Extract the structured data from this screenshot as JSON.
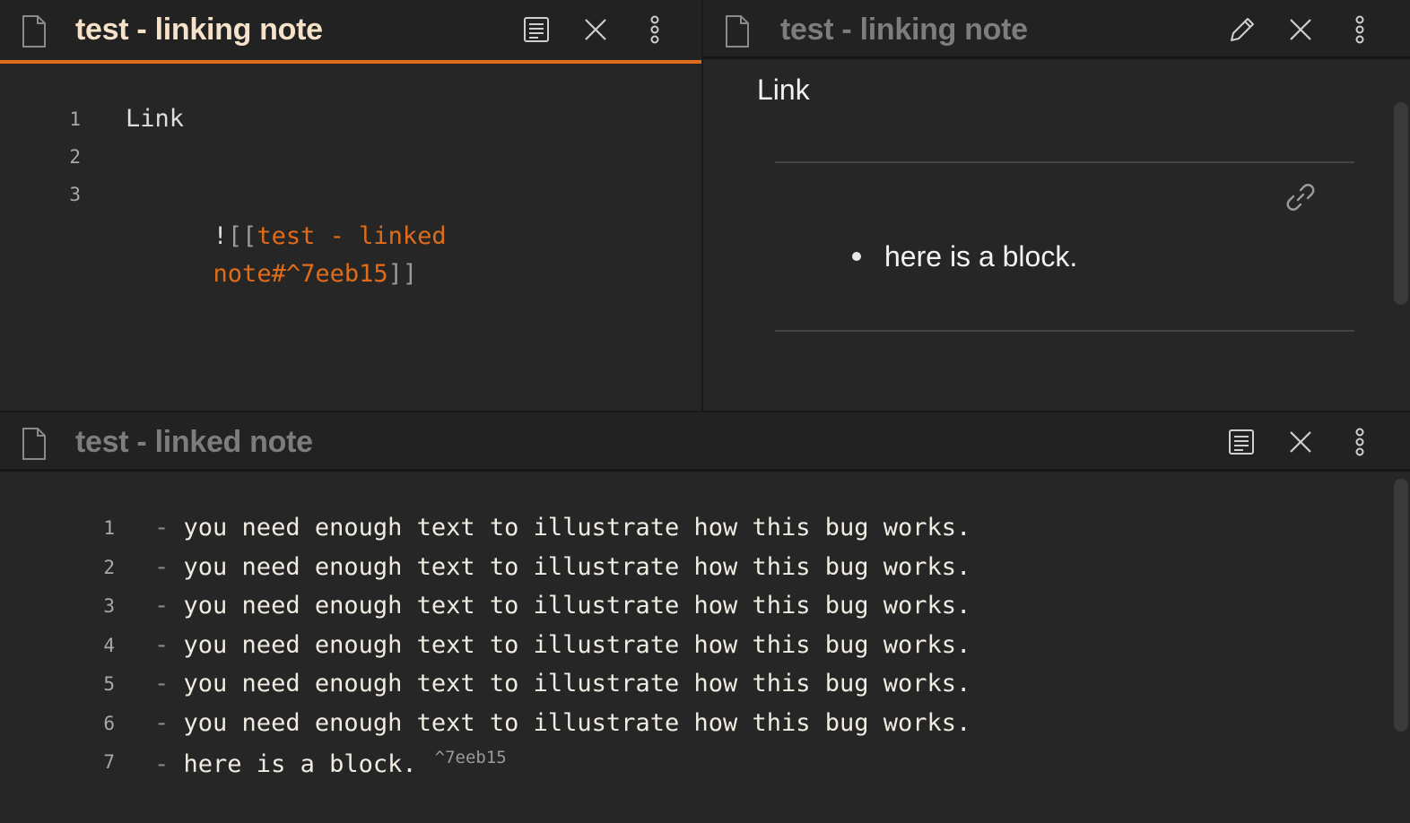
{
  "panes": {
    "top_left": {
      "title": "test - linking note",
      "lines": [
        {
          "num": "1",
          "text": "Link"
        },
        {
          "num": "2",
          "text": ""
        },
        {
          "num": "3",
          "prefix": "!",
          "bracket_open": "[[",
          "link_line1": "test - linked",
          "link_line2": "note#^7eeb15",
          "bracket_close": "]]"
        }
      ]
    },
    "top_right": {
      "title": "test - linking note",
      "heading_text": "Link",
      "embed_bullet": "here is a block."
    },
    "bottom": {
      "title": "test - linked note",
      "lines": [
        {
          "num": "1",
          "dash": "-",
          "text": "you need enough text to illustrate how this bug works."
        },
        {
          "num": "2",
          "dash": "-",
          "text": "you need enough text to illustrate how this bug works."
        },
        {
          "num": "3",
          "dash": "-",
          "text": "you need enough text to illustrate how this bug works."
        },
        {
          "num": "4",
          "dash": "-",
          "text": "you need enough text to illustrate how this bug works."
        },
        {
          "num": "5",
          "dash": "-",
          "text": "you need enough text to illustrate how this bug works."
        },
        {
          "num": "6",
          "dash": "-",
          "text": "you need enough text to illustrate how this bug works."
        },
        {
          "num": "7",
          "dash": "-",
          "text": "here is a block.",
          "block_id": "^7eeb15"
        }
      ]
    }
  },
  "icons": {
    "file": "file-icon",
    "reading_view": "reading-view-icon",
    "edit": "pencil-icon",
    "close": "close-icon",
    "more": "more-options-icon",
    "link": "link-icon"
  },
  "colors": {
    "accent": "#e06c19",
    "link_text": "#e06c19",
    "active_title": "#f5e2c8",
    "background": "#262626"
  }
}
